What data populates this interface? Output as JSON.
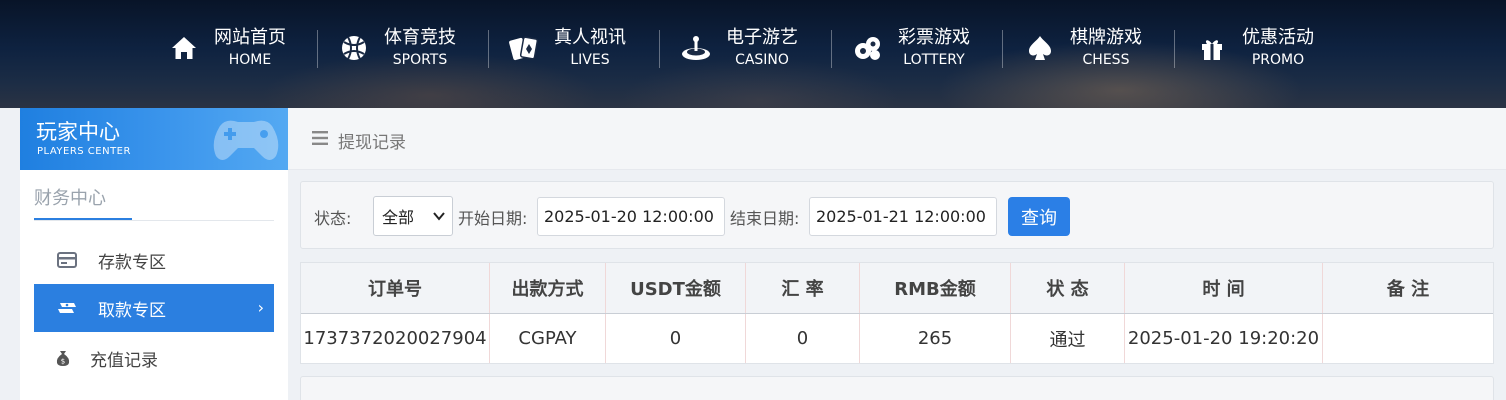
{
  "nav": {
    "items": [
      {
        "cn": "网站首页",
        "en": "HOME",
        "icon": "home-icon"
      },
      {
        "cn": "体育竞技",
        "en": "SPORTS",
        "icon": "basketball-icon"
      },
      {
        "cn": "真人视讯",
        "en": "LIVES",
        "icon": "playing-cards-icon"
      },
      {
        "cn": "电子游艺",
        "en": "CASINO",
        "icon": "roulette-icon"
      },
      {
        "cn": "彩票游戏",
        "en": "LOTTERY",
        "icon": "lottery-balls-icon"
      },
      {
        "cn": "棋牌游戏",
        "en": "CHESS",
        "icon": "spade-icon"
      },
      {
        "cn": "优惠活动",
        "en": "PROMO",
        "icon": "gift-icon"
      }
    ]
  },
  "sidebar": {
    "header_title": "玩家中心",
    "header_sub": "PLAYERS CENTER",
    "section_title": "财务中心",
    "items": [
      {
        "label": "存款专区",
        "icon": "wallet-icon",
        "active": false
      },
      {
        "label": "取款专区",
        "icon": "cash-withdraw-icon",
        "active": true
      },
      {
        "label": "充值记录",
        "icon": "money-bag-icon",
        "active": false
      }
    ],
    "active_arrow": "›"
  },
  "main": {
    "title": "提现记录",
    "title_icon": "list-icon"
  },
  "filter": {
    "status_label": "状态:",
    "status_value": "全部",
    "start_label": "开始日期:",
    "start_value": "2025-01-20 12:00:00",
    "end_label": "结束日期:",
    "end_value": "2025-01-21 12:00:00",
    "query_label": "查询"
  },
  "table": {
    "headers": [
      "订单号",
      "出款方式",
      "USDT金额",
      "汇 率",
      "RMB金额",
      "状 态",
      "时 间",
      "备 注"
    ],
    "rows": [
      [
        "1737372020027904",
        "CGPAY",
        "0",
        "0",
        "265",
        "通过",
        "2025-01-20 19:20:20",
        ""
      ]
    ]
  },
  "colors": {
    "accent": "#2b7fe0",
    "nav_bg": "#0e2240"
  }
}
